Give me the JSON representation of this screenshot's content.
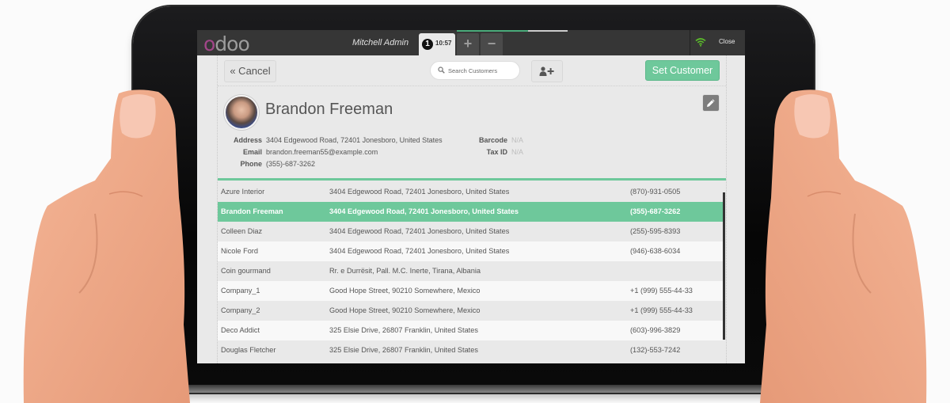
{
  "topbar": {
    "logo": "odoo",
    "logo_first": "o",
    "logo_rest": "doo",
    "user": "Mitchell Admin",
    "order": {
      "number": "1",
      "time": "10:57"
    },
    "add_order_label": "+",
    "remove_order_label": "−",
    "close_label": "Close",
    "wifi_status": "connected"
  },
  "toolbar": {
    "cancel_label": "« Cancel",
    "search_placeholder": "Search Customers",
    "search_value": "",
    "add_customer_icon": "user-plus-icon",
    "set_customer_label": "Set Customer"
  },
  "customer": {
    "name": "Brandon Freeman",
    "fields_left": [
      {
        "label": "Address",
        "value": "3404 Edgewood Road, 72401 Jonesboro, United States"
      },
      {
        "label": "Email",
        "value": "brandon.freeman55@example.com"
      },
      {
        "label": "Phone",
        "value": "(355)-687-3262"
      }
    ],
    "fields_right": [
      {
        "label": "Barcode",
        "value": "N/A"
      },
      {
        "label": "Tax ID",
        "value": "N/A"
      }
    ],
    "edit_icon": "pencil-icon"
  },
  "customers": [
    {
      "name": "Azure Interior",
      "address": "3404 Edgewood Road, 72401 Jonesboro, United States",
      "phone": "(870)-931-0505",
      "selected": false
    },
    {
      "name": "Brandon Freeman",
      "address": "3404 Edgewood Road, 72401 Jonesboro, United States",
      "phone": "(355)-687-3262",
      "selected": true
    },
    {
      "name": "Colleen Diaz",
      "address": "3404 Edgewood Road, 72401 Jonesboro, United States",
      "phone": "(255)-595-8393",
      "selected": false
    },
    {
      "name": "Nicole Ford",
      "address": "3404 Edgewood Road, 72401 Jonesboro, United States",
      "phone": "(946)-638-6034",
      "selected": false
    },
    {
      "name": "Coin gourmand",
      "address": "Rr. e Durrësit, Pall. M.C. Inerte, Tirana, Albania",
      "phone": "",
      "selected": false
    },
    {
      "name": "Company_1",
      "address": "Good Hope Street, 90210 Somewhere, Mexico",
      "phone": "+1 (999) 555-44-33",
      "selected": false
    },
    {
      "name": "Company_2",
      "address": "Good Hope Street, 90210 Somewhere, Mexico",
      "phone": "+1 (999) 555-44-33",
      "selected": false
    },
    {
      "name": "Deco Addict",
      "address": "325 Elsie Drive, 26807 Franklin, United States",
      "phone": "(603)-996-3829",
      "selected": false
    },
    {
      "name": "Douglas Fletcher",
      "address": "325 Elsie Drive, 26807 Franklin, United States",
      "phone": "(132)-553-7242",
      "selected": false
    }
  ],
  "colors": {
    "accent_green": "#6ec89b",
    "logo_purple": "#a24689",
    "topbar": "#363636",
    "wifi_green": "#5cbf2a"
  }
}
